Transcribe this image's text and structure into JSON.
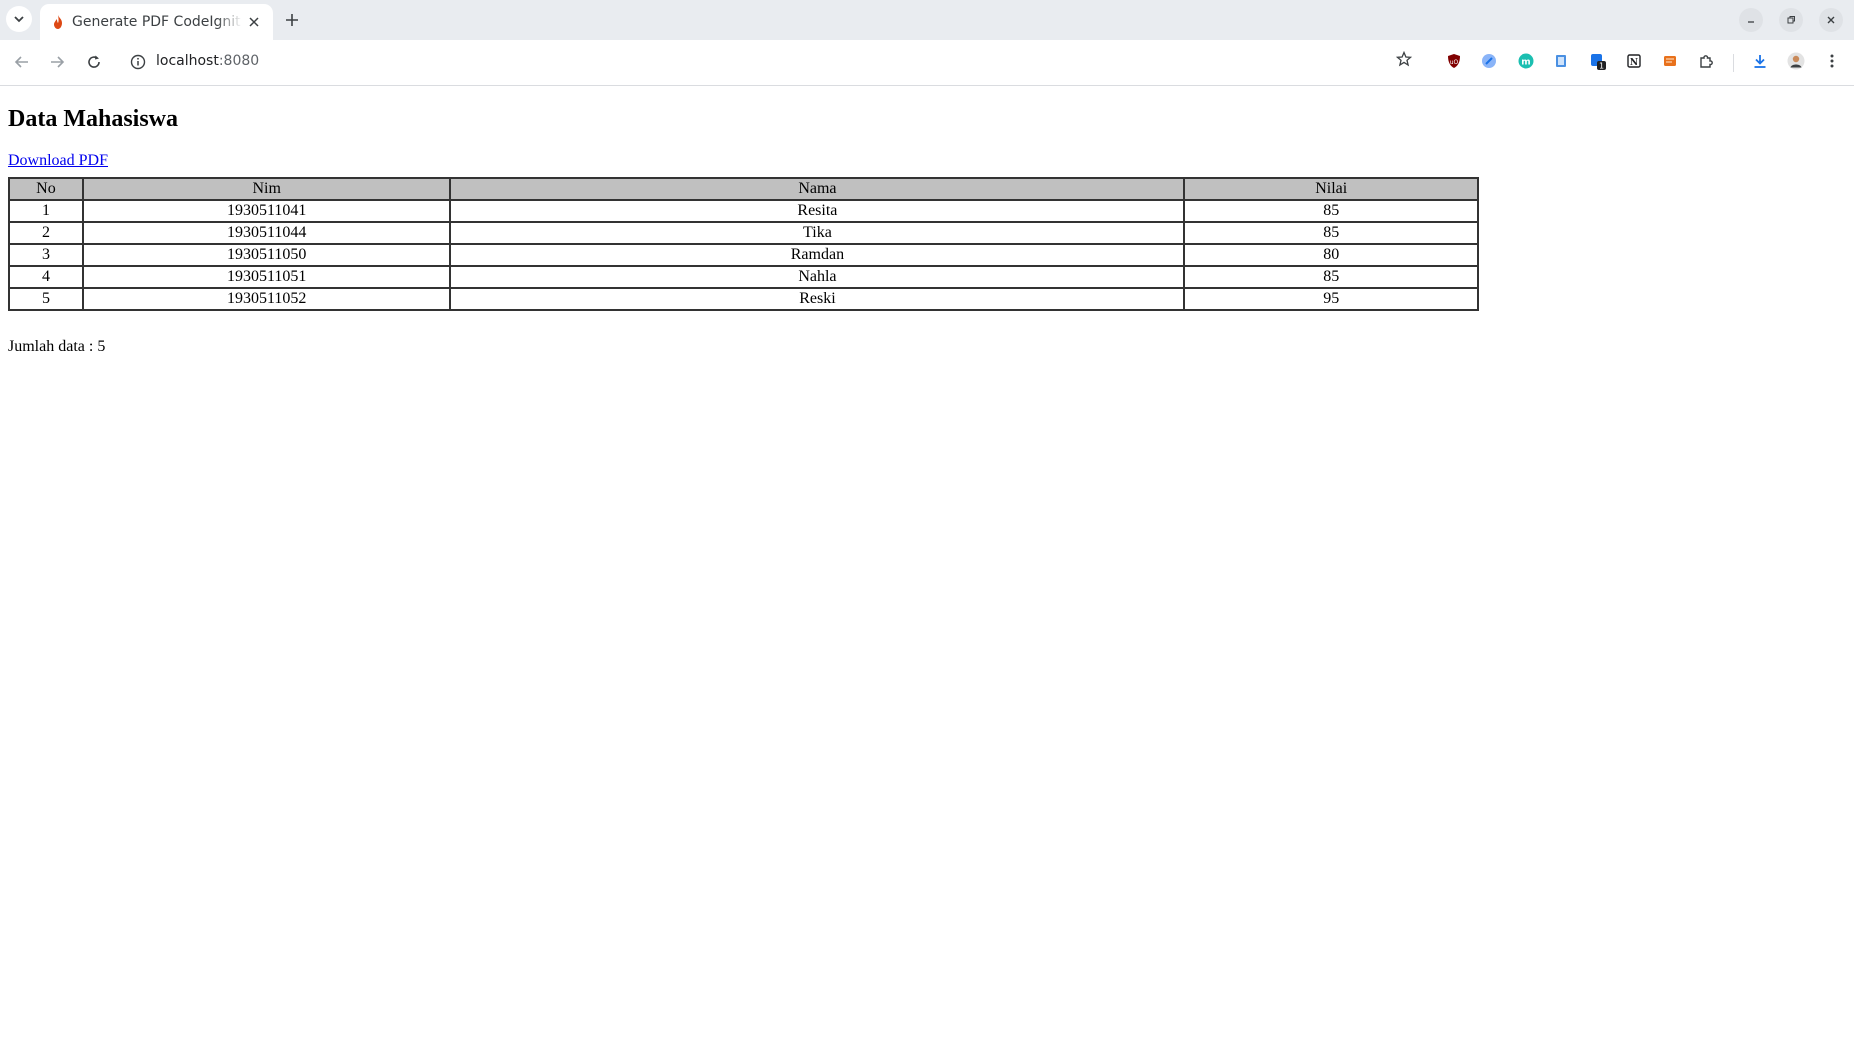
{
  "browser": {
    "tab": {
      "title": "Generate PDF CodeIgnit"
    },
    "address": {
      "host": "localhost",
      "port": ":8080"
    }
  },
  "page": {
    "title": "Data Mahasiswa",
    "download_link": "Download PDF",
    "table": {
      "headers": [
        "No",
        "Nim",
        "Nama",
        "Nilai"
      ],
      "rows": [
        [
          "1",
          "1930511041",
          "Resita",
          "85"
        ],
        [
          "2",
          "1930511044",
          "Tika",
          "85"
        ],
        [
          "3",
          "1930511050",
          "Ramdan",
          "80"
        ],
        [
          "4",
          "1930511051",
          "Nahla",
          "85"
        ],
        [
          "5",
          "1930511052",
          "Reski",
          "95"
        ]
      ]
    },
    "total_label": "Jumlah data : 5"
  },
  "colors": {
    "link": "#0000ee",
    "table_header_bg": "#c0c0c0",
    "tabstrip_bg": "#e9ecf0"
  },
  "icons": {
    "favicon": "codeigniter-flame-icon",
    "extensions": [
      "ublock-origin-icon",
      "extension-icon",
      "m-extension-icon",
      "document-extension-icon",
      "badge-extension-icon",
      "notion-icon",
      "orange-extension-icon",
      "puzzle-extensions-icon"
    ],
    "extension_badge": "1"
  }
}
